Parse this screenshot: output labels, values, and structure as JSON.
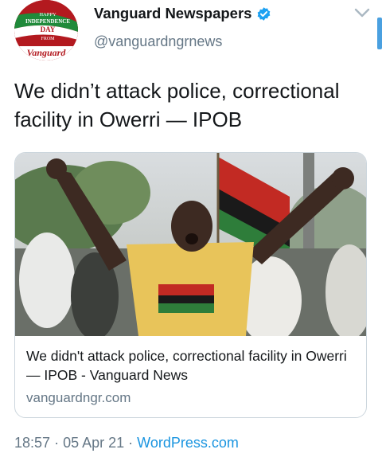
{
  "account": {
    "display_name": "Vanguard Newspapers",
    "handle": "@vanguardngrnews",
    "verified": true,
    "avatar": {
      "line1": "HAPPY",
      "line2": "INDEPENDENCE",
      "line3": "DAY",
      "line4": "FROM",
      "brand": "Vanguard"
    }
  },
  "tweet": {
    "text": "We didn’t attack police, correctional facility in Owerri — IPOB"
  },
  "card": {
    "title": "We didn't attack police, correctional facility in Owerri — IPOB - Vanguard News",
    "domain": "vanguardngr.com"
  },
  "meta": {
    "time": "18:57",
    "separator": "·",
    "date": "05 Apr 21",
    "source": "WordPress.com"
  },
  "colors": {
    "accent": "#1b95e0",
    "verified": "#1da1f2",
    "muted": "#657786",
    "border": "#ccd6dd"
  }
}
